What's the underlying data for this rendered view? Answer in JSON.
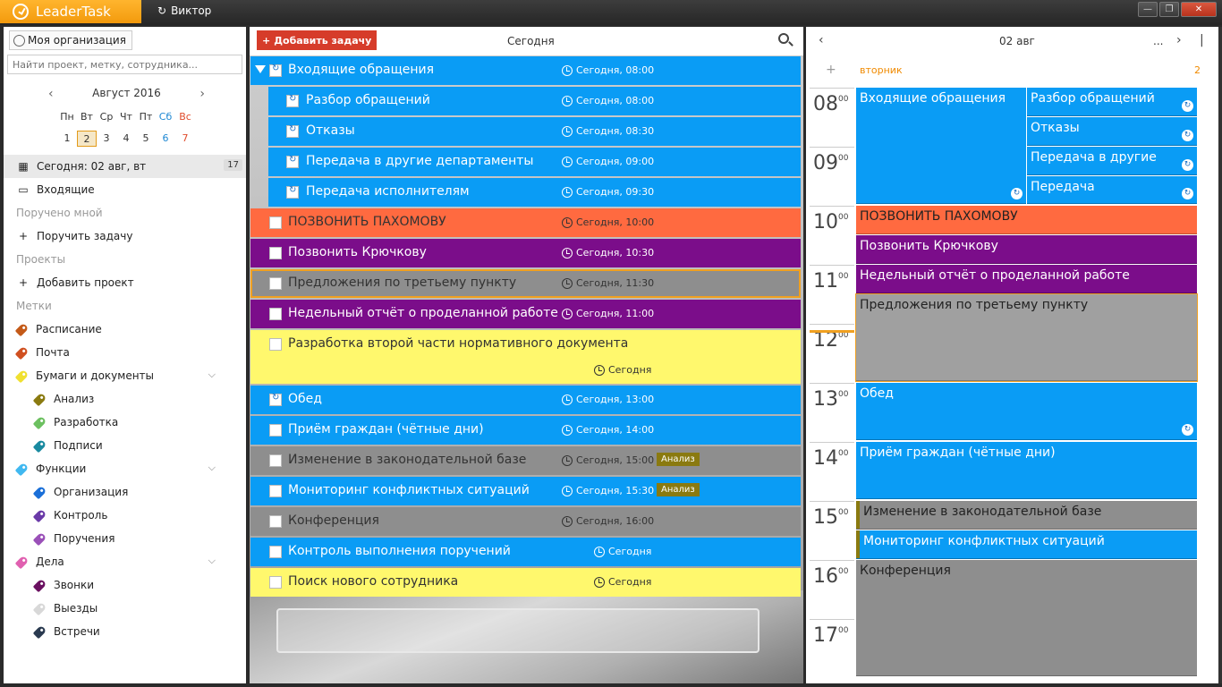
{
  "app": {
    "name": "LeaderTask",
    "user": "Виктор",
    "window_buttons": [
      "—",
      "❐",
      "✕"
    ]
  },
  "left": {
    "org_button": "Моя организация",
    "search_placeholder": "Найти проект, метку, сотрудника...",
    "calendar": {
      "month": "Август 2016",
      "weekdays": [
        "Пн",
        "Вт",
        "Ср",
        "Чт",
        "Пт",
        "Сб",
        "Вс"
      ],
      "days": [
        "1",
        "2",
        "3",
        "4",
        "5",
        "6",
        "7"
      ],
      "selected_day": "2"
    },
    "nav": [
      {
        "label": "Сегодня: 02 авг, вт",
        "count": "17",
        "icon": "calendar-icon",
        "type": "active"
      },
      {
        "label": "Входящие",
        "icon": "inbox-icon",
        "type": "item"
      },
      {
        "label": "Поручено мной",
        "type": "section"
      },
      {
        "label": "Поручить задачу",
        "icon": "plus-icon",
        "type": "item"
      },
      {
        "label": "Проекты",
        "type": "section"
      },
      {
        "label": "Добавить проект",
        "icon": "plus-icon",
        "type": "item"
      },
      {
        "label": "Метки",
        "type": "section"
      },
      {
        "label": "Расписание",
        "tag_color": "#c45a18",
        "type": "tag"
      },
      {
        "label": "Почта",
        "tag_color": "#d05020",
        "type": "tag"
      },
      {
        "label": "Бумаги и документы",
        "tag_color": "#f0e030",
        "type": "tag",
        "expandable": true
      },
      {
        "label": "Анализ",
        "tag_color": "#8a7a10",
        "type": "subtag"
      },
      {
        "label": "Разработка",
        "tag_color": "#6cc060",
        "type": "subtag"
      },
      {
        "label": "Подписи",
        "tag_color": "#1a8aa0",
        "type": "subtag"
      },
      {
        "label": "Функции",
        "tag_color": "#40b8f0",
        "type": "tag",
        "expandable": true
      },
      {
        "label": "Организация",
        "tag_color": "#1a6fd8",
        "type": "subtag"
      },
      {
        "label": "Контроль",
        "tag_color": "#6a3aa8",
        "type": "subtag"
      },
      {
        "label": "Поручения",
        "tag_color": "#9a50b8",
        "type": "subtag"
      },
      {
        "label": "Дела",
        "tag_color": "#e060b0",
        "type": "tag",
        "expandable": true
      },
      {
        "label": "Звонки",
        "tag_color": "#6a1060",
        "type": "subtag"
      },
      {
        "label": "Выезды",
        "tag_color": "#d8d8d8",
        "type": "subtag"
      },
      {
        "label": "Встречи",
        "tag_color": "#2a3a50",
        "type": "subtag"
      }
    ]
  },
  "middle": {
    "add_button": "Добавить задачу",
    "title": "Сегодня",
    "tasks": [
      {
        "title": "Входящие обращения",
        "time": "Сегодня, 08:00",
        "color": "blue",
        "level": 0,
        "repeat": true,
        "group": true
      },
      {
        "title": "Разбор обращений",
        "time": "Сегодня, 08:00",
        "color": "blue",
        "level": 1,
        "repeat": true
      },
      {
        "title": "Отказы",
        "time": "Сегодня, 08:30",
        "color": "blue",
        "level": 1,
        "repeat": true
      },
      {
        "title": "Передача в другие департаменты",
        "time": "Сегодня, 09:00",
        "color": "blue",
        "level": 1,
        "repeat": true
      },
      {
        "title": "Передача исполнителям",
        "time": "Сегодня, 09:30",
        "color": "blue",
        "level": 1,
        "repeat": true
      },
      {
        "title": "ПОЗВОНИТЬ ПАХОМОВУ",
        "time": "Сегодня, 10:00",
        "color": "orange",
        "level": 0
      },
      {
        "title": "Позвонить Крючкову",
        "time": "Сегодня, 10:30",
        "color": "purple",
        "level": 0
      },
      {
        "title": "Предложения по третьему пункту",
        "time": "Сегодня, 11:30",
        "color": "gray",
        "level": 0,
        "selected": true
      },
      {
        "title": "Недельный отчёт о проделанной работе",
        "time": "Сегодня, 11:00",
        "color": "purple",
        "level": 0
      },
      {
        "title": "Разработка второй части нормативного документа",
        "time": "Сегодня",
        "color": "yellow",
        "level": 0,
        "tall": true
      },
      {
        "title": "Обед",
        "time": "Сегодня, 13:00",
        "color": "blue",
        "level": 0,
        "repeat": true
      },
      {
        "title": "Приём граждан (чётные дни)",
        "time": "Сегодня, 14:00",
        "color": "blue",
        "level": 0
      },
      {
        "title": "Изменение в законодательной базе",
        "time": "Сегодня, 15:00",
        "color": "gray",
        "level": 0,
        "badge": "Анализ"
      },
      {
        "title": "Мониторинг конфликтных ситуаций",
        "time": "Сегодня, 15:30",
        "color": "blue",
        "level": 0,
        "badge": "Анализ"
      },
      {
        "title": "Конференция",
        "time": "Сегодня, 16:00",
        "color": "gray",
        "level": 0
      },
      {
        "title": "Контроль выполнения поручений",
        "time": "Сегодня",
        "color": "blue",
        "level": 0
      },
      {
        "title": "Поиск нового сотрудника",
        "time": "Сегодня",
        "color": "yellow",
        "level": 0
      }
    ]
  },
  "right": {
    "date": "02 авг",
    "more": "...",
    "weekday": "вторник",
    "day_number": "2",
    "hours": [
      "08",
      "09",
      "10",
      "11",
      "12",
      "13",
      "14",
      "15",
      "16",
      "17"
    ],
    "minutes": "00",
    "events": [
      {
        "title": "Входящие обращения"
      },
      {
        "title": "Разбор обращений"
      },
      {
        "title": "Отказы"
      },
      {
        "title": "Передача в другие"
      },
      {
        "title": "Передача"
      },
      {
        "title": "ПОЗВОНИТЬ ПАХОМОВУ"
      },
      {
        "title": "Позвонить Крючкову"
      },
      {
        "title": "Недельный отчёт о проделанной работе"
      },
      {
        "title": "Предложения по третьему пункту"
      },
      {
        "title": "Обед"
      },
      {
        "title": "Приём граждан (чётные дни)"
      },
      {
        "title": "Изменение в законодательной базе"
      },
      {
        "title": "Мониторинг конфликтных ситуаций"
      },
      {
        "title": "Конференция"
      }
    ]
  }
}
